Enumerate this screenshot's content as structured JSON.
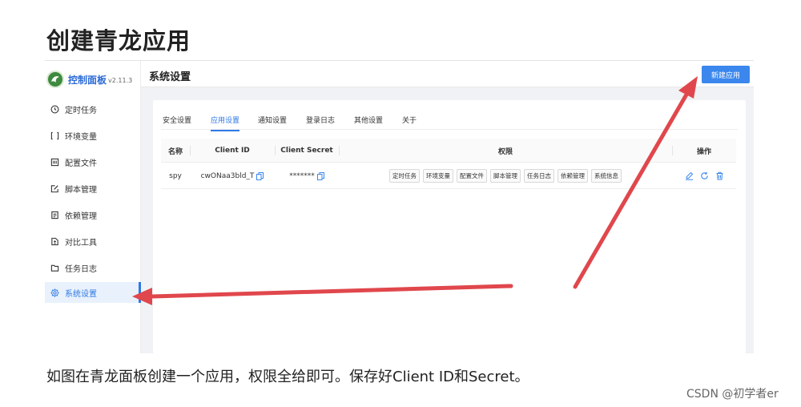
{
  "heading": "创建青龙应用",
  "sidebar": {
    "logo_text": "控制面板",
    "version": "v2.11.3",
    "items": [
      {
        "label": "定时任务",
        "icon": "clock-icon"
      },
      {
        "label": "环境变量",
        "icon": "variable-icon"
      },
      {
        "label": "配置文件",
        "icon": "config-file-icon"
      },
      {
        "label": "脚本管理",
        "icon": "edit-script-icon"
      },
      {
        "label": "依赖管理",
        "icon": "package-icon"
      },
      {
        "label": "对比工具",
        "icon": "diff-icon"
      },
      {
        "label": "任务日志",
        "icon": "folder-icon"
      },
      {
        "label": "系统设置",
        "icon": "gear-icon",
        "active": true
      }
    ]
  },
  "main": {
    "title": "系统设置",
    "new_app_button": "新建应用",
    "tabs": [
      {
        "label": "安全设置"
      },
      {
        "label": "应用设置",
        "active": true
      },
      {
        "label": "通知设置"
      },
      {
        "label": "登录日志"
      },
      {
        "label": "其他设置"
      },
      {
        "label": "关于"
      }
    ],
    "table": {
      "columns": [
        "名称",
        "Client ID",
        "Client Secret",
        "权限",
        "操作"
      ],
      "rows": [
        {
          "name": "spy",
          "client_id": "cwONaa3bld_T",
          "client_secret": "*******",
          "permissions": [
            "定时任务",
            "环境变量",
            "配置文件",
            "脚本管理",
            "任务日志",
            "依赖管理",
            "系统信息"
          ],
          "actions": [
            "edit-icon",
            "refresh-icon",
            "delete-icon"
          ]
        }
      ]
    }
  },
  "caption": "如图在青龙面板创建一个应用，权限全给即可。保存好Client ID和Secret。",
  "watermark": "CSDN @初学者er",
  "colors": {
    "accent": "#3b87ee",
    "arrow": "#e0474c",
    "active_bg": "#e8f1fc"
  }
}
